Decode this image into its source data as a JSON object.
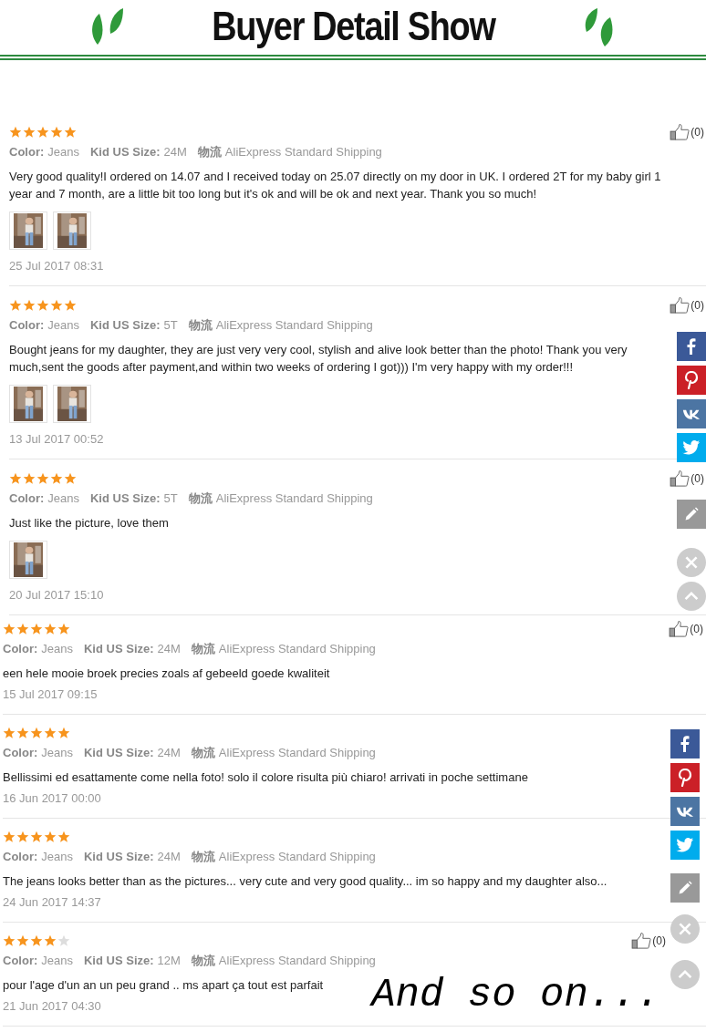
{
  "header": {
    "title": "Buyer Detail Show"
  },
  "panels": [
    {
      "reviews": [
        {
          "stars": 5,
          "color_label": "Color:",
          "variant": "Jeans",
          "size_label": "Kid US Size:",
          "size": "24M",
          "ship_label": "物流",
          "shipping": "AliExpress Standard Shipping",
          "text": "Very good quality!I ordered on 14.07 and I received today on 25.07 directly on my door in UK. I ordered 2T for my baby girl 1 year and 7 month, are a little bit too long but it's ok and will be ok and next year. Thank you so much!",
          "photos": [
            {
              "kind": "picture"
            },
            {
              "kind": "picture"
            }
          ],
          "date": "25 Jul 2017 08:31",
          "likes": "(0)"
        },
        {
          "stars": 5,
          "color_label": "Color:",
          "variant": "Jeans",
          "size_label": "Kid US Size:",
          "size": "5T",
          "ship_label": "物流",
          "shipping": "AliExpress Standard Shipping",
          "text": "Bought jeans for my daughter, they are just very very cool, stylish and alive look better than the photo! Thank you very much,sent the goods after payment,and within two weeks of ordering I got))) I'm very happy with my order!!!",
          "photos": [
            {
              "kind": "picture"
            },
            {
              "kind": "picture"
            }
          ],
          "date": "13 Jul 2017 00:52",
          "likes": "(0)"
        },
        {
          "stars": 5,
          "color_label": "Color:",
          "variant": "Jeans",
          "size_label": "Kid US Size:",
          "size": "5T",
          "ship_label": "物流",
          "shipping": "AliExpress Standard Shipping",
          "text": "Just like the picture, love them",
          "photos": [
            {
              "kind": "picture"
            }
          ],
          "date": "20 Jul 2017 15:10",
          "likes": "(0)"
        }
      ],
      "share_bar": [
        {
          "kind": "facebook"
        },
        {
          "kind": "pinterest"
        },
        {
          "kind": "vk"
        },
        {
          "kind": "twitter"
        },
        {
          "kind": "edit"
        },
        {
          "kind": "close"
        },
        {
          "kind": "top"
        }
      ]
    },
    {
      "reviews": [
        {
          "stars": 5,
          "color_label": "Color:",
          "variant": "Jeans",
          "size_label": "Kid US Size:",
          "size": "24M",
          "ship_label": "物流",
          "shipping": "AliExpress Standard Shipping",
          "text": "een hele mooie broek precies zoals af gebeeld goede kwaliteit",
          "date": "15 Jul 2017 09:15",
          "likes": "(0)"
        },
        {
          "stars": 5,
          "color_label": "Color:",
          "variant": "Jeans",
          "size_label": "Kid US Size:",
          "size": "24M",
          "ship_label": "物流",
          "shipping": "AliExpress Standard Shipping",
          "text": "Bellissimi ed esattamente come nella foto! solo il colore risulta più chiaro! arrivati in poche settimane",
          "date": "16 Jun 2017 00:00"
        },
        {
          "stars": 5,
          "color_label": "Color:",
          "variant": "Jeans",
          "size_label": "Kid US Size:",
          "size": "24M",
          "ship_label": "物流",
          "shipping": "AliExpress Standard Shipping",
          "text": "The jeans looks better than as the pictures... very cute and very good quality... im so happy and my daughter also...",
          "date": "24 Jun 2017 14:37"
        },
        {
          "stars": 4,
          "color_label": "Color:",
          "variant": "Jeans",
          "size_label": "Kid US Size:",
          "size": "12M",
          "ship_label": "物流",
          "shipping": "AliExpress Standard Shipping",
          "text": "pour l'age d'un an un peu grand .. ms apart ça tout est parfait",
          "date": "21 Jun 2017 04:30",
          "likes": "(0)"
        }
      ],
      "share_bar": [
        {
          "kind": "facebook"
        },
        {
          "kind": "pinterest"
        },
        {
          "kind": "vk"
        },
        {
          "kind": "twitter"
        },
        {
          "kind": "edit"
        },
        {
          "kind": "close"
        },
        {
          "kind": "top"
        }
      ]
    }
  ],
  "caption": "And so on..."
}
